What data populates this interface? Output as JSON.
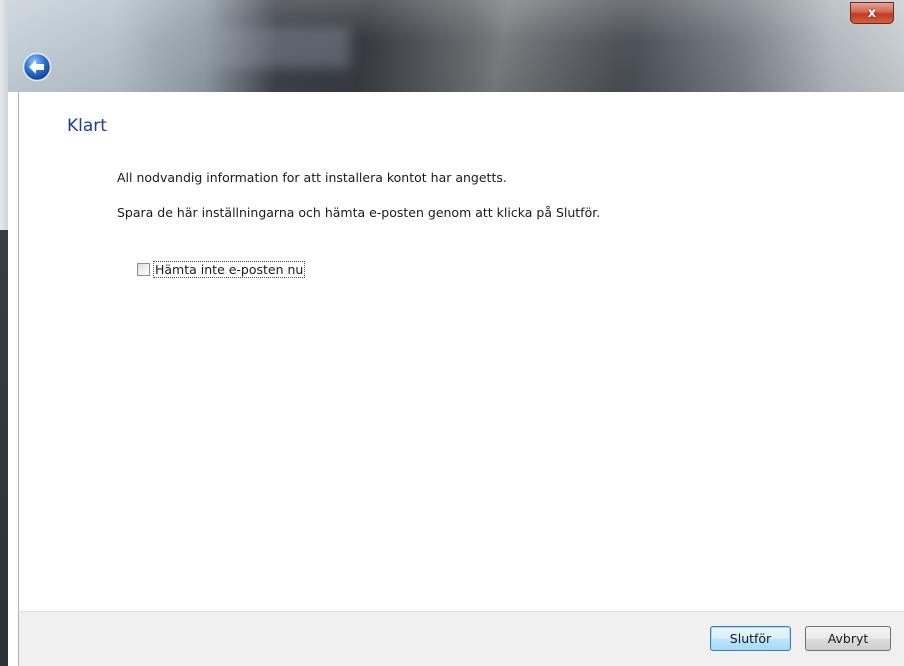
{
  "window": {
    "close_symbol": "x"
  },
  "nav": {
    "back_icon": "back-arrow-icon"
  },
  "page": {
    "heading": "Klart",
    "paragraph_1": "All nodvandig information for att installera kontot har angetts.",
    "paragraph_2": "Spara de här inställningarna och hämta e-posten genom att klicka på Slutför."
  },
  "options": {
    "dont_fetch_label": "Hämta inte e-posten nu",
    "dont_fetch_checked": false
  },
  "footer": {
    "finish_label": "Slutför",
    "cancel_label": "Avbryt"
  },
  "colors": {
    "heading": "#1e3f8f",
    "close_button": "#c23c22",
    "back_button": "#1f5fbf",
    "footer_background": "#f0f0f0"
  }
}
